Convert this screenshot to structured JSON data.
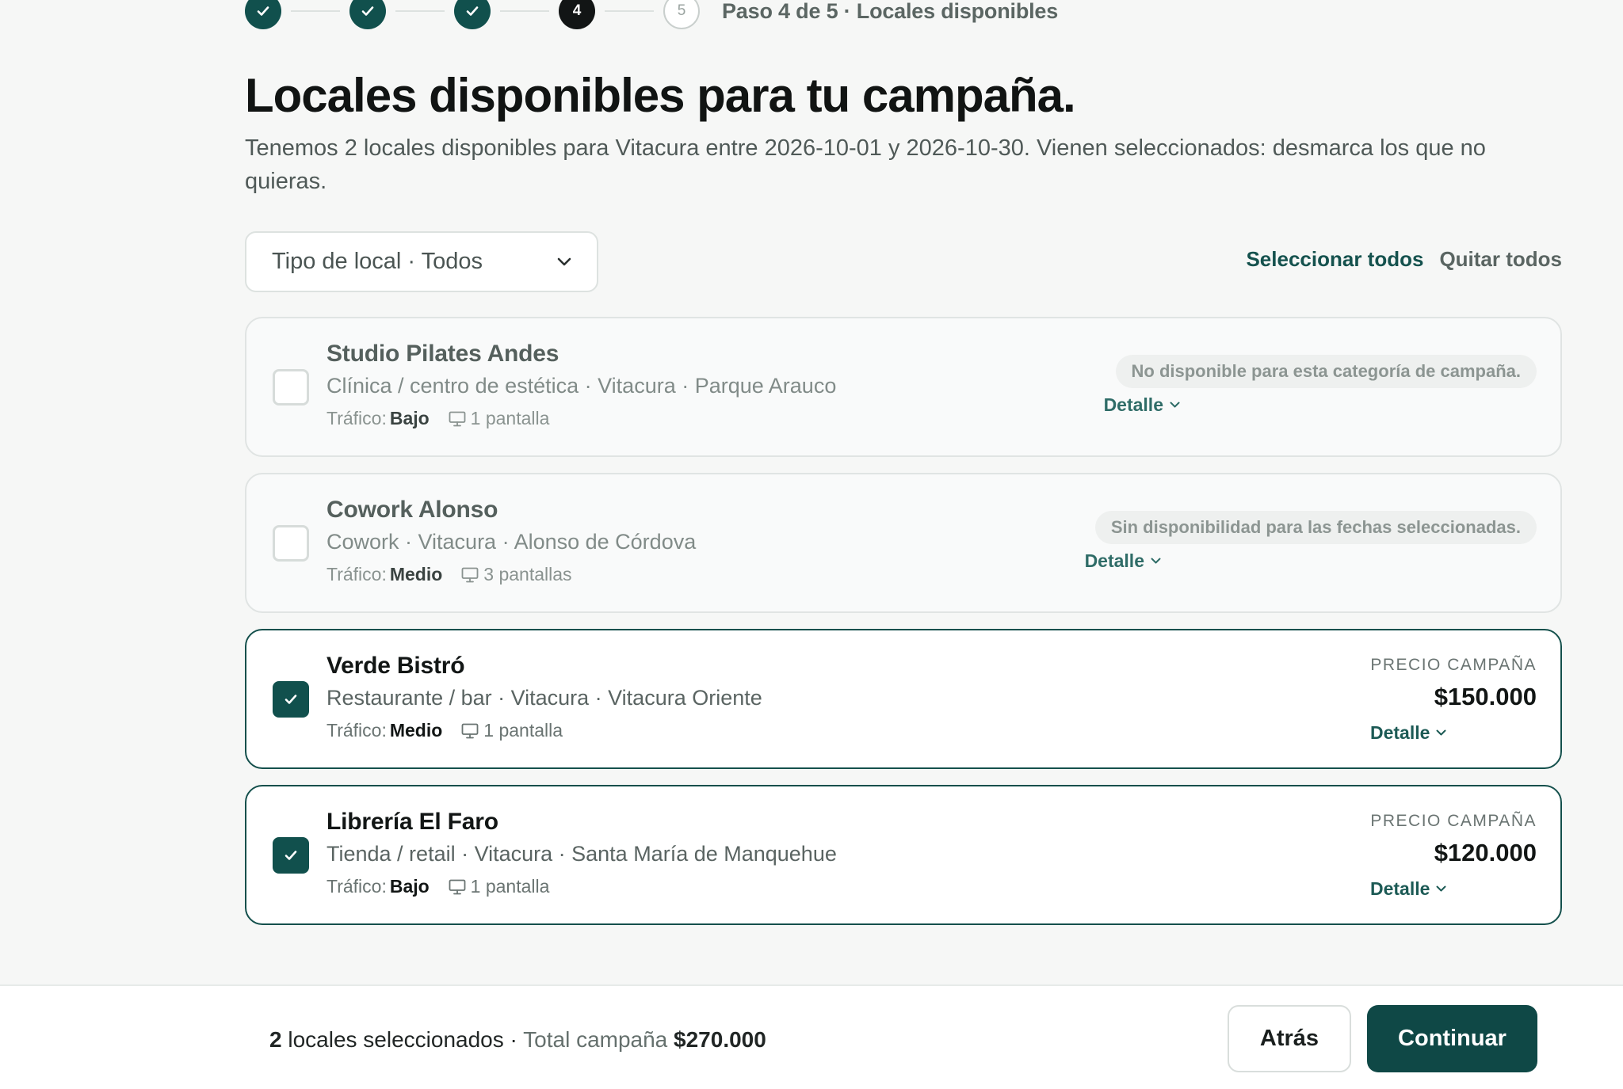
{
  "stepper": {
    "steps": [
      {
        "label": "",
        "state": "done"
      },
      {
        "label": "",
        "state": "done"
      },
      {
        "label": "",
        "state": "done"
      },
      {
        "label": "4",
        "state": "current"
      },
      {
        "label": "5",
        "state": "todo"
      }
    ],
    "caption": "Paso 4 de 5 · Locales disponibles"
  },
  "title": "Locales disponibles para tu campaña.",
  "subtitle": "Tenemos 2 locales disponibles para Vitacura entre 2026-10-01 y 2026-10-30. Vienen seleccionados: desmarca los que no quieras.",
  "filter": {
    "value": "Tipo de local · Todos"
  },
  "actions": {
    "select_all": "Seleccionar todos",
    "clear_all": "Quitar todos"
  },
  "labels": {
    "traffic": "Tráfico:",
    "price": "PRECIO CAMPAÑA",
    "detail": "Detalle"
  },
  "venues": [
    {
      "name": "Studio Pilates Andes",
      "meta": "Clínica / centro de estética · Vitacura · Parque Arauco",
      "traffic": "Bajo",
      "screens": "1 pantalla",
      "selected": false,
      "status": "No disponible para esta categoría de campaña."
    },
    {
      "name": "Cowork Alonso",
      "meta": "Cowork · Vitacura · Alonso de Córdova",
      "traffic": "Medio",
      "screens": "3 pantallas",
      "selected": false,
      "status": "Sin disponibilidad para las fechas seleccionadas."
    },
    {
      "name": "Verde Bistró",
      "meta": "Restaurante / bar · Vitacura · Vitacura Oriente",
      "traffic": "Medio",
      "screens": "1 pantalla",
      "selected": true,
      "price": "$150.000"
    },
    {
      "name": "Librería El Faro",
      "meta": "Tienda / retail · Vitacura · Santa María de Manquehue",
      "traffic": "Bajo",
      "screens": "1 pantalla",
      "selected": true,
      "price": "$120.000"
    }
  ],
  "footer": {
    "count": "2",
    "count_label": "locales seleccionados ·",
    "total_label": "Total campaña",
    "total": "$270.000",
    "back": "Atrás",
    "next": "Continuar"
  },
  "colors": {
    "accent": "#11504d",
    "text": "#111413",
    "muted": "#5a6562"
  }
}
